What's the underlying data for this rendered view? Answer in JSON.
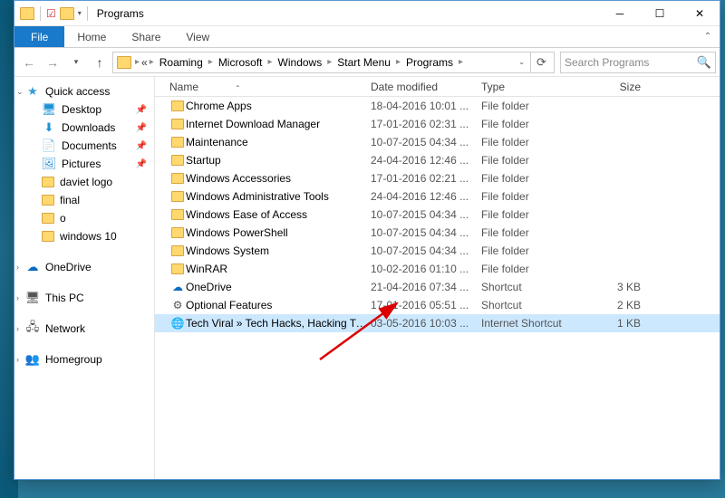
{
  "title": "Programs",
  "ribbon": {
    "file": "File",
    "home": "Home",
    "share": "Share",
    "view": "View"
  },
  "breadcrumb": {
    "segments": [
      "Roaming",
      "Microsoft",
      "Windows",
      "Start Menu",
      "Programs"
    ],
    "ellipsis": "«"
  },
  "search": {
    "placeholder": "Search Programs"
  },
  "navpane": {
    "quick_access": "Quick access",
    "quick_items": [
      {
        "label": "Desktop",
        "icon": "🖥",
        "color": "#1e90d6"
      },
      {
        "label": "Downloads",
        "icon": "⬇",
        "color": "#1e90d6"
      },
      {
        "label": "Documents",
        "icon": "📄",
        "color": "#5a5a5a"
      },
      {
        "label": "Pictures",
        "icon": "🖼",
        "color": "#3a99d8"
      },
      {
        "label": "daviet logo",
        "icon": "folder",
        "color": ""
      },
      {
        "label": "final",
        "icon": "folder",
        "color": ""
      },
      {
        "label": "o",
        "icon": "folder",
        "color": ""
      },
      {
        "label": "windows 10",
        "icon": "folder",
        "color": ""
      }
    ],
    "onedrive": "OneDrive",
    "thispc": "This PC",
    "network": "Network",
    "homegroup": "Homegroup"
  },
  "columns": {
    "name": "Name",
    "date": "Date modified",
    "type": "Type",
    "size": "Size"
  },
  "rows": [
    {
      "name": "Chrome Apps",
      "date": "18-04-2016 10:01 ...",
      "type": "File folder",
      "size": "",
      "icon": "folder"
    },
    {
      "name": "Internet Download Manager",
      "date": "17-01-2016 02:31 ...",
      "type": "File folder",
      "size": "",
      "icon": "folder"
    },
    {
      "name": "Maintenance",
      "date": "10-07-2015 04:34 ...",
      "type": "File folder",
      "size": "",
      "icon": "folder"
    },
    {
      "name": "Startup",
      "date": "24-04-2016 12:46 ...",
      "type": "File folder",
      "size": "",
      "icon": "folder"
    },
    {
      "name": "Windows Accessories",
      "date": "17-01-2016 02:21 ...",
      "type": "File folder",
      "size": "",
      "icon": "folder"
    },
    {
      "name": "Windows Administrative Tools",
      "date": "24-04-2016 12:46 ...",
      "type": "File folder",
      "size": "",
      "icon": "folder"
    },
    {
      "name": "Windows Ease of Access",
      "date": "10-07-2015 04:34 ...",
      "type": "File folder",
      "size": "",
      "icon": "folder"
    },
    {
      "name": "Windows PowerShell",
      "date": "10-07-2015 04:34 ...",
      "type": "File folder",
      "size": "",
      "icon": "folder"
    },
    {
      "name": "Windows System",
      "date": "10-07-2015 04:34 ...",
      "type": "File folder",
      "size": "",
      "icon": "folder"
    },
    {
      "name": "WinRAR",
      "date": "10-02-2016 01:10 ...",
      "type": "File folder",
      "size": "",
      "icon": "folder"
    },
    {
      "name": "OneDrive",
      "date": "21-04-2016 07:34 ...",
      "type": "Shortcut",
      "size": "3 KB",
      "icon": "onedrive"
    },
    {
      "name": "Optional Features",
      "date": "17-01-2016 05:51 ...",
      "type": "Shortcut",
      "size": "2 KB",
      "icon": "settings"
    },
    {
      "name": "Tech Viral » Tech Hacks, Hacking Tutoria...",
      "date": "03-05-2016 10:03 ...",
      "type": "Internet Shortcut",
      "size": "1 KB",
      "icon": "chrome",
      "selected": true
    }
  ]
}
